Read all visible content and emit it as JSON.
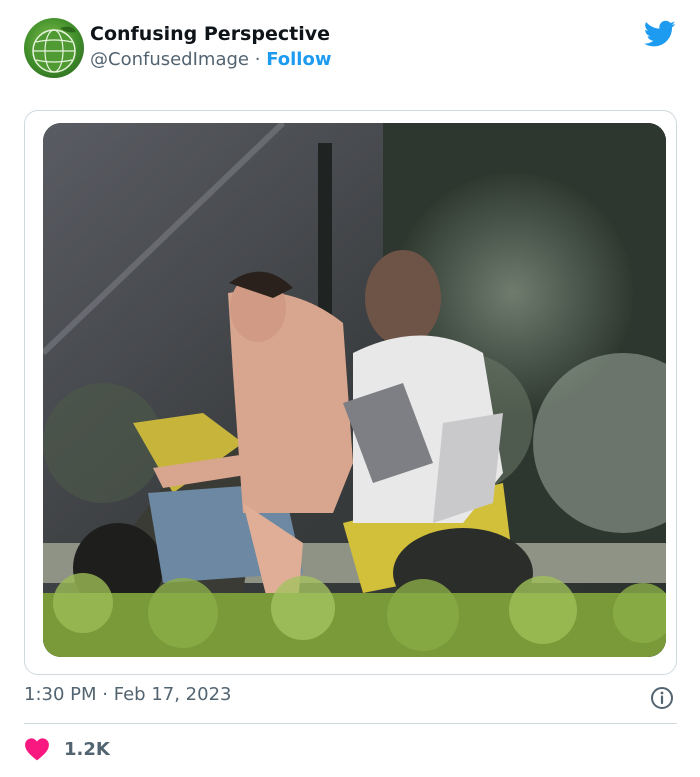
{
  "tweet": {
    "author": {
      "name": "Confusing Perspective",
      "handle": "@ConfusedImage",
      "separator": "·",
      "follow_label": "Follow",
      "avatar_icon": "globe-avatar-icon"
    },
    "brand_icon": "twitter-bird-icon",
    "brand_color": "#1d9bf0",
    "media": {
      "type": "photo"
    },
    "timestamp": {
      "time": "1:30 PM",
      "separator": "·",
      "date": "Feb 17, 2023"
    },
    "info_icon": "info-icon",
    "engagement": {
      "like_icon": "heart-icon",
      "like_color": "#f91880",
      "like_count": "1.2K"
    }
  }
}
